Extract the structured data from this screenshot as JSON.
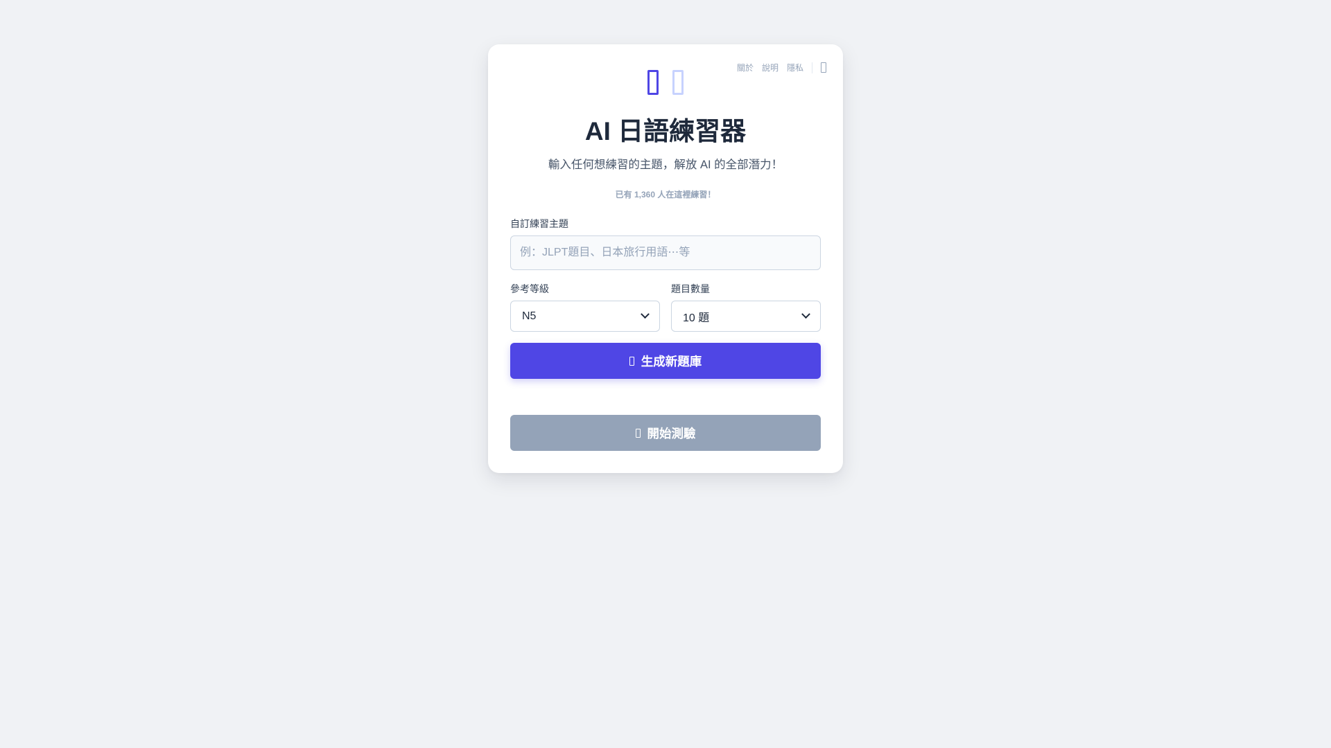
{
  "nav": {
    "about": "關於",
    "help": "說明",
    "privacy": "隱私"
  },
  "header": {
    "title": "AI 日語練習器",
    "subtitle": "輸入任何想練習的主題，解放 AI 的全部潛力！",
    "counter": "已有 1,360 人在這裡練習！"
  },
  "form": {
    "topic_label": "自訂練習主題",
    "topic_placeholder": "例：JLPT題目、日本旅行用語⋯等",
    "topic_value": "",
    "level_label": "參考等級",
    "level_value": "N5",
    "count_label": "題目數量",
    "count_value": "10 題"
  },
  "actions": {
    "generate_label": "生成新題庫",
    "start_label": "開始測驗"
  },
  "colors": {
    "accent": "#4f46e5",
    "disabled": "#94a3b8",
    "background": "#f0f2f5"
  },
  "icons": {
    "logo": [
      "logo-icon-primary",
      "logo-icon-secondary"
    ],
    "menu": "menu-icon",
    "generate": "sparkle-icon",
    "start": "play-icon"
  }
}
